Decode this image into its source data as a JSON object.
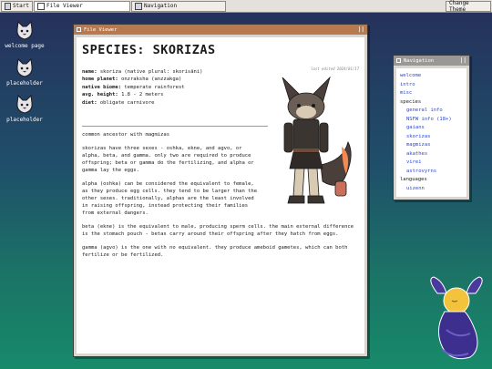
{
  "taskbar": {
    "start_label": "Start",
    "tasks": [
      {
        "label": "File Viewer"
      },
      {
        "label": "Navigation"
      }
    ],
    "theme_button": "Change Theme"
  },
  "desktop": {
    "icons": [
      {
        "label": "welcome page",
        "icon": "cat-face-icon"
      },
      {
        "label": "placeholder",
        "icon": "cat-face-icon"
      },
      {
        "label": "placeholder",
        "icon": "cat-face-icon"
      }
    ]
  },
  "file_viewer": {
    "window_title": "File Viewer",
    "close_label": "||",
    "page_title": "SPECIES: SKORIZAS",
    "last_edited": "last edited 2024/01/17",
    "info": [
      {
        "key": "name:",
        "value": "skoriza (native plural: skorisāni)"
      },
      {
        "key": "home planet:",
        "value": "onzraksha (anzzakga)"
      },
      {
        "key": "native biome:",
        "value": "temperate rainforest"
      },
      {
        "key": "avg. height:",
        "value": "1.8 - 2 meters"
      },
      {
        "key": "diet:",
        "value": "obligate carnivore"
      }
    ],
    "paragraphs": [
      "common ancestor with magmizas",
      "skorizas have three sexes - oshka, ekne, and agvo, or alpha, beta, and gamma. only two are required to produce offspring; beta or gamma do the fertilizing, and alpha or gamma lay the eggs.",
      "alpha (oshka) can be considered the equivalent to female, as they produce egg cells. they tend to be larger than the other sexes. traditionally, alphas are the least involved in raising offspring, instead protecting their families from external dangers.",
      "beta (ekne) is the equivalent to male, producing sperm cells. the main external difference is the stomach pouch - betas carry around their offspring after they hatch from eggs.",
      "gamma (agvo) is the one with no equivalent. they produce ameboid gametes, which can both fertilize or be fertilized."
    ]
  },
  "navigation": {
    "window_title": "Navigation",
    "close_label": "||",
    "items": [
      {
        "label": "welcome",
        "type": "link"
      },
      {
        "label": "intro",
        "type": "link"
      },
      {
        "label": "misc",
        "type": "link"
      },
      {
        "label": "species",
        "type": "heading"
      },
      {
        "label": "general info",
        "type": "sublink"
      },
      {
        "label": "NSFW info (18+)",
        "type": "sublink"
      },
      {
        "label": "gaians",
        "type": "sublink"
      },
      {
        "label": "skorizas",
        "type": "sublink"
      },
      {
        "label": "magmizas",
        "type": "sublink"
      },
      {
        "label": "akathes",
        "type": "sublink"
      },
      {
        "label": "virei",
        "type": "sublink"
      },
      {
        "label": "astrovyrns",
        "type": "sublink"
      },
      {
        "label": "languages",
        "type": "heading"
      },
      {
        "label": "uizenn",
        "type": "sublink"
      }
    ]
  },
  "colors": {
    "file_viewer_titlebar": "#b8794f",
    "nav_titlebar": "#9a9896",
    "link": "#2b49c9"
  }
}
